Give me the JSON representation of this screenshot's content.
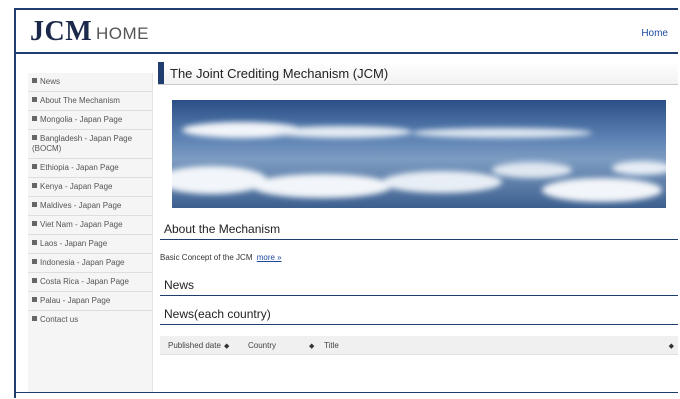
{
  "header": {
    "brand": "JCM",
    "brand_sub": "HOME",
    "home_link": "Home"
  },
  "sidebar": {
    "items": [
      {
        "label": "News"
      },
      {
        "label": "About The Mechanism"
      },
      {
        "label": "Mongolia - Japan Page"
      },
      {
        "label": "Bangladesh - Japan Page (BOCM)"
      },
      {
        "label": "Ethiopia - Japan Page"
      },
      {
        "label": "Kenya - Japan Page"
      },
      {
        "label": "Maldives - Japan Page"
      },
      {
        "label": "Viet Nam - Japan Page"
      },
      {
        "label": "Laos - Japan Page"
      },
      {
        "label": "Indonesia - Japan Page"
      },
      {
        "label": "Costa Rica - Japan Page"
      },
      {
        "label": "Palau - Japan Page"
      },
      {
        "label": "Contact us"
      }
    ]
  },
  "main": {
    "title": "The Joint Crediting Mechanism (JCM)",
    "about_heading": "About the Mechanism",
    "about_desc": "Basic Concept of the JCM",
    "more_link": "more »",
    "news_heading": "News",
    "news_country_heading": "News(each country)",
    "table": {
      "columns": [
        "Published date",
        "Country",
        "Title"
      ],
      "sort_glyph": "◆"
    }
  },
  "colors": {
    "accent": "#1f3d6e",
    "link": "#1f4aa0"
  }
}
